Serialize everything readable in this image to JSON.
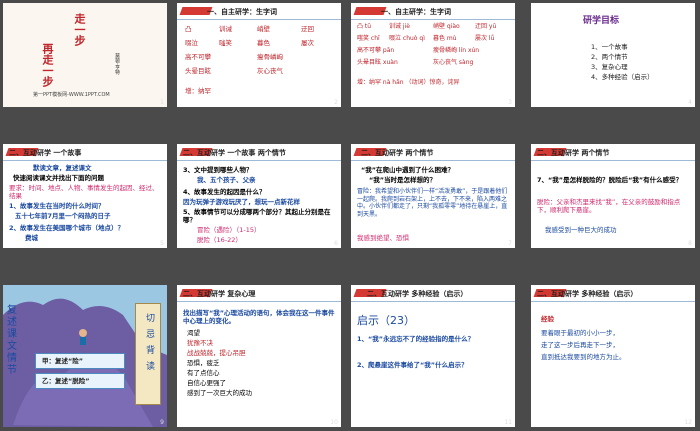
{
  "slides": [
    {
      "num": "1",
      "title_lines": [
        "走一步",
        "再走一步"
      ],
      "author": "莫顿·亨特",
      "footer": "第一PPT模板网-WWW.1PPT.COM"
    },
    {
      "num": "2",
      "header": "一、自主研学：生字词",
      "words": [
        "凸",
        "训诫",
        "峭壁",
        "迂回",
        "啜泣",
        "嗤笑",
        "暮色",
        "屡次",
        "高不可攀",
        "瘦骨嶙峋",
        "头晕目眩",
        "灰心丧气"
      ],
      "extra": "增：纳罕"
    },
    {
      "num": "3",
      "header": "一、自主研学：生字词",
      "words": [
        "凸 tū",
        "训诫 jiè",
        "峭壁 qiào",
        "迂回 yū",
        "嗤笑 chī",
        "啜泣 chuò qì",
        "暮色 mù",
        "屡次 lǚ",
        "高不可攀 pān",
        "瘦骨嶙峋 lín xún",
        "头晕目眩 xuàn",
        "灰心丧气 sàng"
      ],
      "extra": "增：纳罕  nà hǎn （动词）惊奇，诧异"
    },
    {
      "num": "4",
      "title": "研学目标",
      "items": [
        "1、一个故事",
        "2、两个情节",
        "3、复杂心理",
        "4、多种经验（启示）"
      ]
    },
    {
      "num": "5",
      "header": "二、互动研学  一个故事",
      "lines": [
        "默读文章，复述课文",
        "快速阅读课文并找出下面的问题",
        "要求：时间、地点、人物、事情发生的起因、经过、结果",
        "1、故事发生在当时的什么时间？",
        "五十七年前7月里一个闷热的日子",
        "2、故事发生在美国哪个城市（地点）？",
        "费城"
      ]
    },
    {
      "num": "6",
      "header": "二、互动研学  一个故事  两个情节",
      "lines": [
        "3、文中提到哪些人物？",
        "我、五个孩子、父亲",
        "4、故事发生的起因是什么？",
        "因为玩弹子游戏玩厌了，想玩一点新花样",
        "5、故事情节可以分成哪两个部分？其起止分别是在哪？",
        "冒险（遇险）（1-15）",
        "脱险（16-22）"
      ]
    },
    {
      "num": "7",
      "header": "二、互动研学  两个情节",
      "lines": [
        "“我”在爬山中遇到了什么困难？",
        "“我”当时是怎样想的？",
        "冒险：我希望和小伙伴们一样“活泼勇敢”，于是跟着他们一起爬。我爬到岩石架上，上不去，下不来，陷入两难之中。小伙伴们都走了，只剩“我孤零零”地待在悬崖上，直到天黑。",
        "我感到绝望、恐惧"
      ]
    },
    {
      "num": "8",
      "header": "二、互动研学  两个情节",
      "lines": [
        "7、“我”是怎样脱险的？脱险后“我”有什么感受？",
        "脱险：父亲和杰里来找“我”，在父亲的鼓励和指点下，顺利爬下悬崖。",
        "我感受到一种巨大的成功"
      ]
    },
    {
      "num": "9",
      "side_left": [
        "复",
        "述",
        "课",
        "文",
        "情",
        "节"
      ],
      "side_right": [
        "切",
        "忌",
        "背",
        "读"
      ],
      "buttons": [
        "甲：复述“险”",
        "乙：复述“脱险”"
      ]
    },
    {
      "num": "10",
      "header": "二、互动研学  复杂心理",
      "lines": [
        "找出描写“我”心理活动的语句，体会我在这一件事件中心理上的变化。",
        "渴望",
        "犹豫不决",
        "战战兢兢，提心吊胆",
        "恐惧，疲乏",
        "有了点信心",
        "自信心更强了",
        "感到了一次巨大的成功"
      ]
    },
    {
      "num": "11",
      "header": "二、互动研学  多种经验（启示）",
      "lines": [
        "启示（23）",
        "1、“我”永远忘不了的经验指的是什么？",
        "2、爬悬崖这件事给了“我”什么启示？"
      ]
    },
    {
      "num": "12",
      "header": "二、互动研学  多种经验（启示）",
      "lines": [
        "经验",
        "要着眼于最初的小小一步，",
        "走了这一步后再走下一步，",
        "直到抵达我要到的地方为止。"
      ]
    }
  ],
  "colors": {
    "accent": "#c0262c",
    "blue": "#1b4aa0",
    "bg": "#4a4a4a"
  }
}
